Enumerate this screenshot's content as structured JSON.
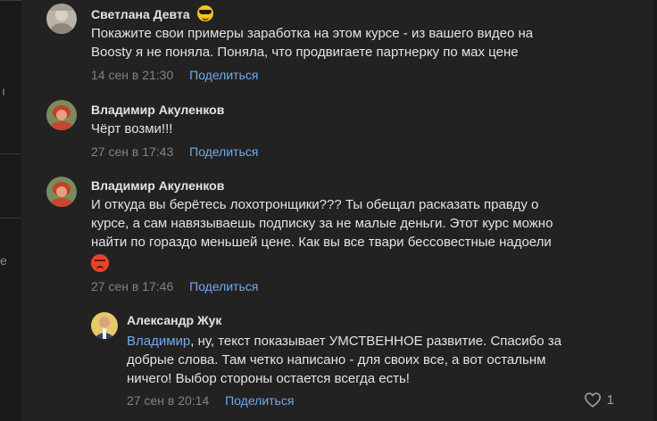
{
  "sidebar": {
    "fragment_1": "ı",
    "fragment_2": "e"
  },
  "comments": [
    {
      "author": "Светлана Девта",
      "author_emoji": "smiling-face-with-sunglasses",
      "lines": [
        "Покажите свои примеры заработка на этом курсе - из вашего видео на",
        "Boosty я не поняла. Поняла, что продвигаете партнерку по мах цене"
      ],
      "date": "14 сен в 21:30",
      "reply_label": "Поделиться"
    },
    {
      "author": "Владимир Акуленков",
      "lines": [
        "Чёрт возми!!!"
      ],
      "date": "27 сен в 17:43",
      "reply_label": "Поделиться"
    },
    {
      "author": "Владимир Акуленков",
      "lines": [
        "И откуда вы берётесь лохотронщики??? Ты обещал расказать правду о",
        "курсе, а сам навязываешь подписку за не малые деньги. Этот курс можно",
        "найти по гораздо меньшей цене. Как вы все твари бессовестные надоели"
      ],
      "text_emoji": "angry-face",
      "date": "27 сен в 17:46",
      "reply_label": "Поделиться"
    }
  ],
  "reply": {
    "author": "Александр Жук",
    "mention": "Владимир",
    "line_1_rest": ", ну, текст показывает УМСТВЕННОЕ развитие. Спасибо за",
    "line_2": "добрые слова. Там четко написано - для своих все, а вот остальнм",
    "line_3": "ничего! Выбор стороны остается всегда есть!",
    "date": "27 сен в 20:14",
    "reply_label": "Поделиться",
    "like_count": "1",
    "like_icon": "heart-outline-icon"
  },
  "colors": {
    "background": "#222222",
    "text": "#e1e3e6",
    "secondary_text": "#828282",
    "link": "#71aaeb"
  }
}
